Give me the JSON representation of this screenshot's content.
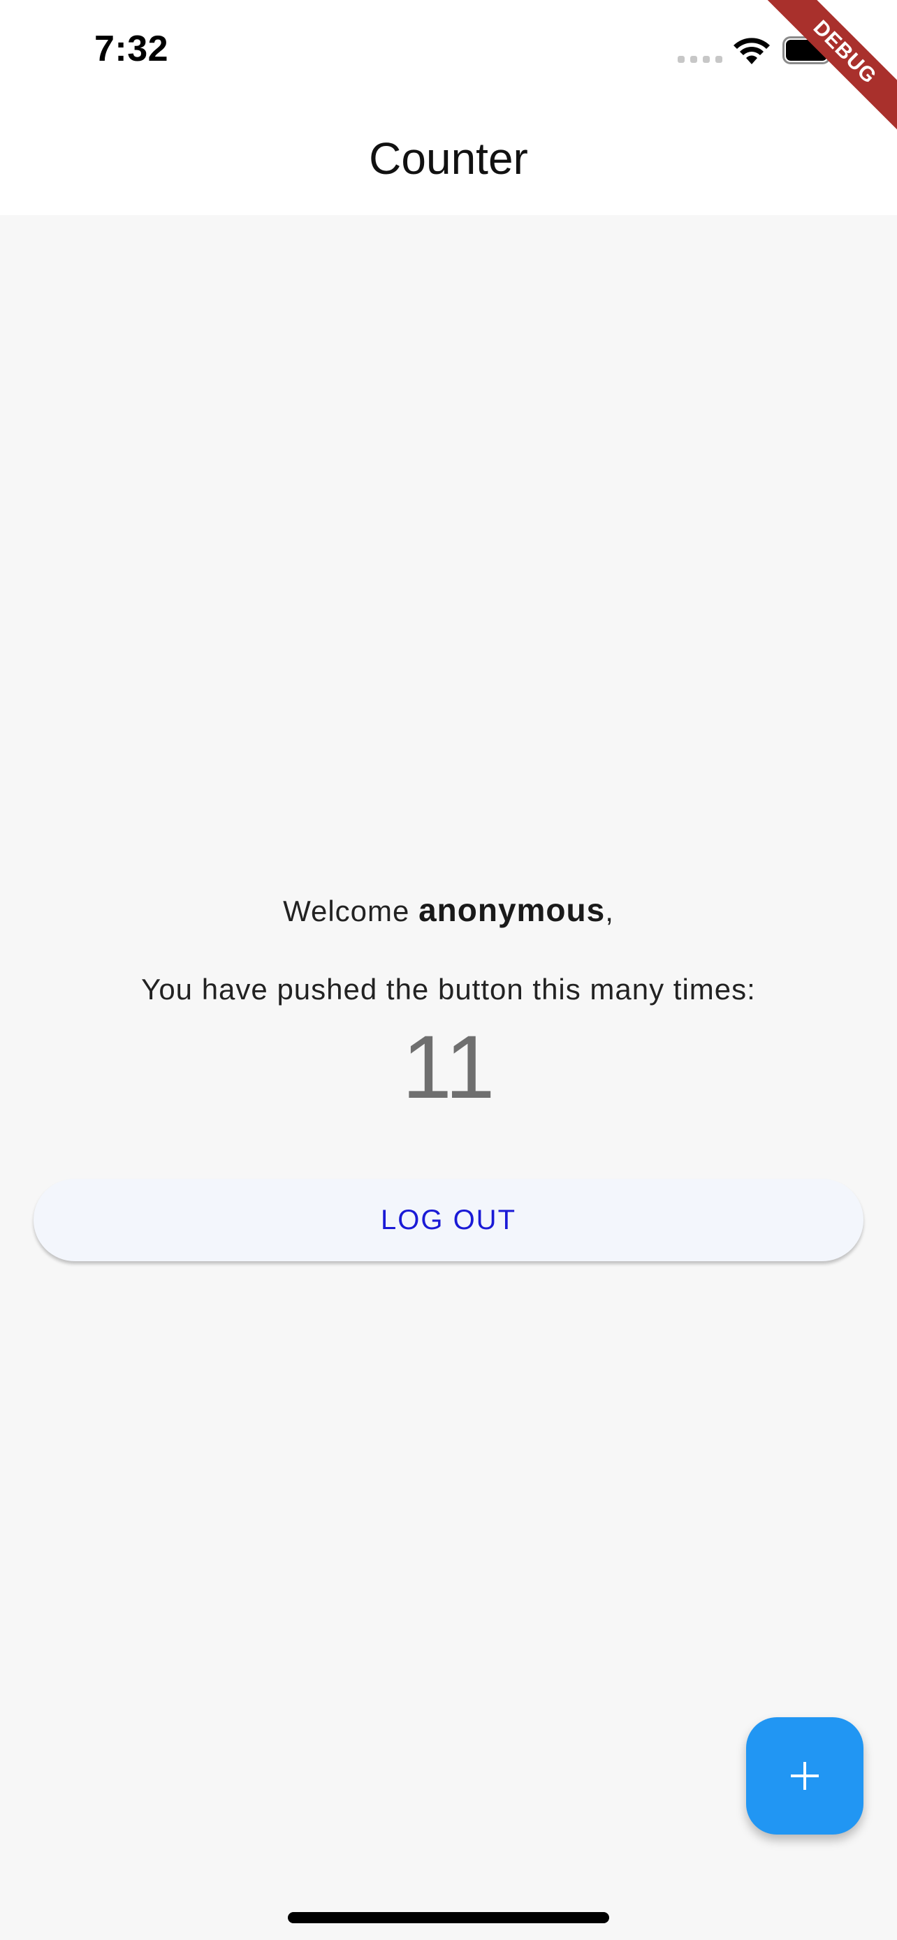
{
  "status_bar": {
    "time": "7:32",
    "icons": [
      "signal-dots-icon",
      "wifi-icon",
      "battery-icon"
    ]
  },
  "debug_banner": {
    "label": "DEBUG",
    "color": "#a9302c"
  },
  "app_bar": {
    "title": "Counter"
  },
  "main": {
    "welcome_prefix": "Welcome ",
    "user_name": "anonymous",
    "welcome_suffix": ",",
    "pushed_label": "You have pushed the button this many times:",
    "counter": "11"
  },
  "logout_button": {
    "label": "LOG OUT"
  },
  "fab": {
    "icon": "plus-icon"
  },
  "colors": {
    "accent": "#2196f3",
    "logout_text": "#1a1ad6",
    "background": "#f7f7f7"
  }
}
